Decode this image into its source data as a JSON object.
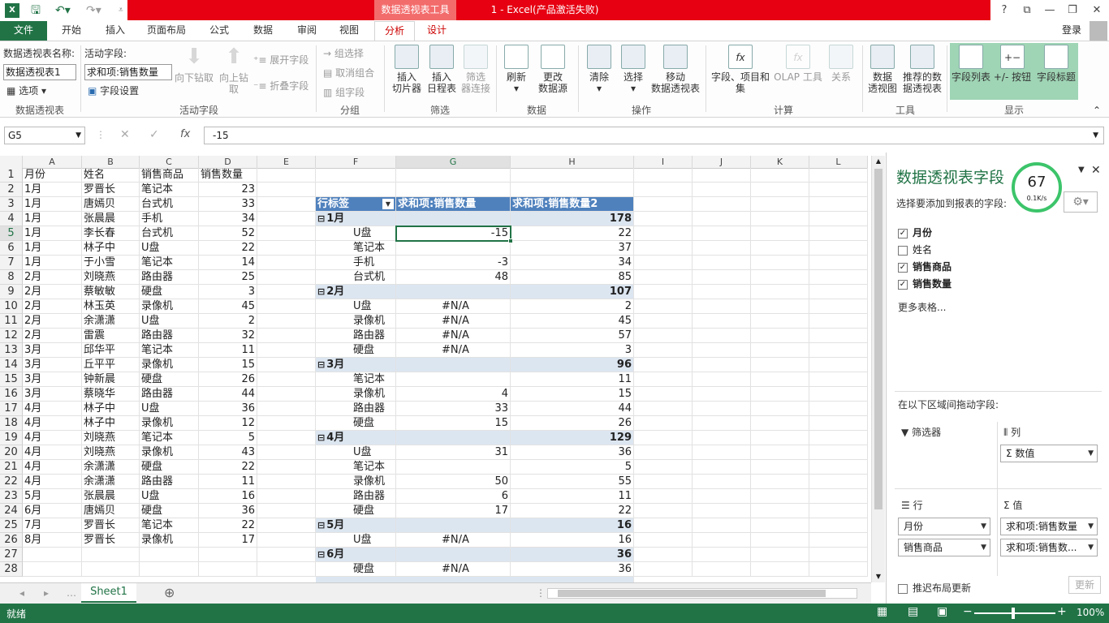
{
  "app": {
    "title": "1 -  Excel(产品激活失败)",
    "context_tab_group": "数据透视表工具",
    "login": "登录"
  },
  "titlebar": {
    "help": "?",
    "restore": "⧉",
    "minimize": "—",
    "maximize": "❐",
    "close": "✕"
  },
  "tabs": [
    "文件",
    "开始",
    "插入",
    "页面布局",
    "公式",
    "数据",
    "审阅",
    "视图",
    "分析",
    "设计"
  ],
  "active_tab": "分析",
  "ribbon": {
    "pivot_name_label": "数据透视表名称:",
    "pivot_name_value": "数据透视表1",
    "options": "选项",
    "group_pivot": "数据透视表",
    "active_field_label": "活动字段:",
    "active_field_value": "求和项:销售数量",
    "field_settings": "字段设置",
    "drill_down": "向下钻取",
    "drill_up": "向上钻",
    "drill_up2": "取",
    "expand_field": "展开字段",
    "collapse_field": "折叠字段",
    "group_active": "活动字段",
    "group_selection": "组选择",
    "ungroup": "取消组合",
    "group_field": "组字段",
    "group_group": "分组",
    "insert_slicer": "插入",
    "insert_slicer2": "切片器",
    "insert_timeline": "插入",
    "insert_timeline2": "日程表",
    "filter_conn": "筛选",
    "filter_conn2": "器连接",
    "group_filter": "筛选",
    "refresh": "刷新",
    "change_source": "更改",
    "change_source2": "数据源",
    "group_data": "数据",
    "clear": "清除",
    "select": "选择",
    "move_pivot": "移动",
    "move_pivot2": "数据透视表",
    "group_actions": "操作",
    "fields_items": "字段、项目和",
    "fields_items2": "集",
    "olap": "OLAP 工具",
    "relations": "关系",
    "group_calc": "计算",
    "pivot_chart": "数据",
    "pivot_chart2": "透视图",
    "recommended": "推荐的数",
    "recommended2": "据透视表",
    "group_tools": "工具",
    "field_list": "字段列表",
    "buttons": "+/- 按钮",
    "field_headers": "字段标题",
    "group_show": "显示"
  },
  "formula": {
    "namebox": "G5",
    "cancel": "✕",
    "enter": "✓",
    "fx": "fx",
    "value": "-15"
  },
  "columns": [
    "A",
    "B",
    "C",
    "D",
    "E",
    "F",
    "G",
    "H",
    "I",
    "J",
    "K",
    "L"
  ],
  "rows": [
    "1",
    "2",
    "3",
    "4",
    "5",
    "6",
    "7",
    "8",
    "9",
    "10",
    "11",
    "12",
    "13",
    "14",
    "15",
    "16",
    "17",
    "18",
    "19",
    "20",
    "21",
    "22",
    "23",
    "24",
    "25",
    "26",
    "27",
    "28"
  ],
  "source_table": [
    [
      "月份",
      "姓名",
      "销售商品",
      "销售数量"
    ],
    [
      "1月",
      "罗晋长",
      "笔记本",
      "23"
    ],
    [
      "1月",
      "唐嫣贝",
      "台式机",
      "33"
    ],
    [
      "1月",
      "张晨晨",
      "手机",
      "34"
    ],
    [
      "1月",
      "李长春",
      "台式机",
      "52"
    ],
    [
      "1月",
      "林子中",
      "U盘",
      "22"
    ],
    [
      "1月",
      "于小雪",
      "笔记本",
      "14"
    ],
    [
      "2月",
      "刘晓燕",
      "路由器",
      "25"
    ],
    [
      "2月",
      "蔡敏敏",
      "硬盘",
      "3"
    ],
    [
      "2月",
      "林玉英",
      "录像机",
      "45"
    ],
    [
      "2月",
      "余潇潇",
      "U盘",
      "2"
    ],
    [
      "2月",
      "雷震",
      "路由器",
      "32"
    ],
    [
      "3月",
      "邱华平",
      "笔记本",
      "11"
    ],
    [
      "3月",
      "丘平平",
      "录像机",
      "15"
    ],
    [
      "3月",
      "钟新晨",
      "硬盘",
      "26"
    ],
    [
      "3月",
      "蔡晓华",
      "路由器",
      "44"
    ],
    [
      "4月",
      "林子中",
      "U盘",
      "36"
    ],
    [
      "4月",
      "林子中",
      "录像机",
      "12"
    ],
    [
      "4月",
      "刘晓燕",
      "笔记本",
      "5"
    ],
    [
      "4月",
      "刘晓燕",
      "录像机",
      "43"
    ],
    [
      "4月",
      "余潇潇",
      "硬盘",
      "22"
    ],
    [
      "4月",
      "余潇潇",
      "路由器",
      "11"
    ],
    [
      "5月",
      "张晨晨",
      "U盘",
      "16"
    ],
    [
      "6月",
      "唐嫣贝",
      "硬盘",
      "36"
    ],
    [
      "7月",
      "罗晋长",
      "笔记本",
      "22"
    ],
    [
      "8月",
      "罗晋长",
      "录像机",
      "17"
    ]
  ],
  "pivot": {
    "headers": [
      "行标签",
      "求和项:销售数量",
      "求和项:销售数量2"
    ],
    "rows": [
      {
        "type": "group",
        "label": "1月",
        "g": "",
        "h": "178"
      },
      {
        "type": "item",
        "label": "U盘",
        "g": "-15",
        "h": "22"
      },
      {
        "type": "item",
        "label": "笔记本",
        "g": "",
        "h": "37"
      },
      {
        "type": "item",
        "label": "手机",
        "g": "-3",
        "h": "34"
      },
      {
        "type": "item",
        "label": "台式机",
        "g": "48",
        "h": "85"
      },
      {
        "type": "group",
        "label": "2月",
        "g": "",
        "h": "107"
      },
      {
        "type": "item",
        "label": "U盘",
        "g": "#N/A",
        "h": "2"
      },
      {
        "type": "item",
        "label": "录像机",
        "g": "#N/A",
        "h": "45"
      },
      {
        "type": "item",
        "label": "路由器",
        "g": "#N/A",
        "h": "57"
      },
      {
        "type": "item",
        "label": "硬盘",
        "g": "#N/A",
        "h": "3"
      },
      {
        "type": "group",
        "label": "3月",
        "g": "",
        "h": "96"
      },
      {
        "type": "item",
        "label": "笔记本",
        "g": "",
        "h": "11"
      },
      {
        "type": "item",
        "label": "录像机",
        "g": "4",
        "h": "15"
      },
      {
        "type": "item",
        "label": "路由器",
        "g": "33",
        "h": "44"
      },
      {
        "type": "item",
        "label": "硬盘",
        "g": "15",
        "h": "26"
      },
      {
        "type": "group",
        "label": "4月",
        "g": "",
        "h": "129"
      },
      {
        "type": "item",
        "label": "U盘",
        "g": "31",
        "h": "36"
      },
      {
        "type": "item",
        "label": "笔记本",
        "g": "",
        "h": "5"
      },
      {
        "type": "item",
        "label": "录像机",
        "g": "50",
        "h": "55"
      },
      {
        "type": "item",
        "label": "路由器",
        "g": "6",
        "h": "11"
      },
      {
        "type": "item",
        "label": "硬盘",
        "g": "17",
        "h": "22"
      },
      {
        "type": "group",
        "label": "5月",
        "g": "",
        "h": "16"
      },
      {
        "type": "item",
        "label": "U盘",
        "g": "#N/A",
        "h": "16"
      },
      {
        "type": "group",
        "label": "6月",
        "g": "",
        "h": "36"
      },
      {
        "type": "item",
        "label": "硬盘",
        "g": "#N/A",
        "h": "36"
      }
    ]
  },
  "sheet_tab": "Sheet1",
  "status": {
    "ready": "就绪",
    "zoom": "100%"
  },
  "pane": {
    "title": "数据透视表字段",
    "subtitle": "选择要添加到报表的字段:",
    "fields": [
      {
        "name": "月份",
        "checked": true
      },
      {
        "name": "姓名",
        "checked": false
      },
      {
        "name": "销售商品",
        "checked": true
      },
      {
        "name": "销售数量",
        "checked": true
      }
    ],
    "more_tables": "更多表格...",
    "drag_label": "在以下区域间拖动字段:",
    "filters": "筛选器",
    "columns": "列",
    "values_item": "Σ 数值",
    "rows": "行",
    "values": "值",
    "row_item1": "月份",
    "row_item2": "销售商品",
    "val_item1": "求和项:销售数量",
    "val_item2": "求和项:销售数...",
    "defer": "推迟布局更新",
    "update": "更新",
    "speed_percent": "67",
    "speed_rate": "0.1K/s"
  },
  "colors": {
    "excel_green": "#217346",
    "title_red": "#e60012",
    "pivot_header": "#4f81bd",
    "pivot_group": "#dce6f1"
  }
}
